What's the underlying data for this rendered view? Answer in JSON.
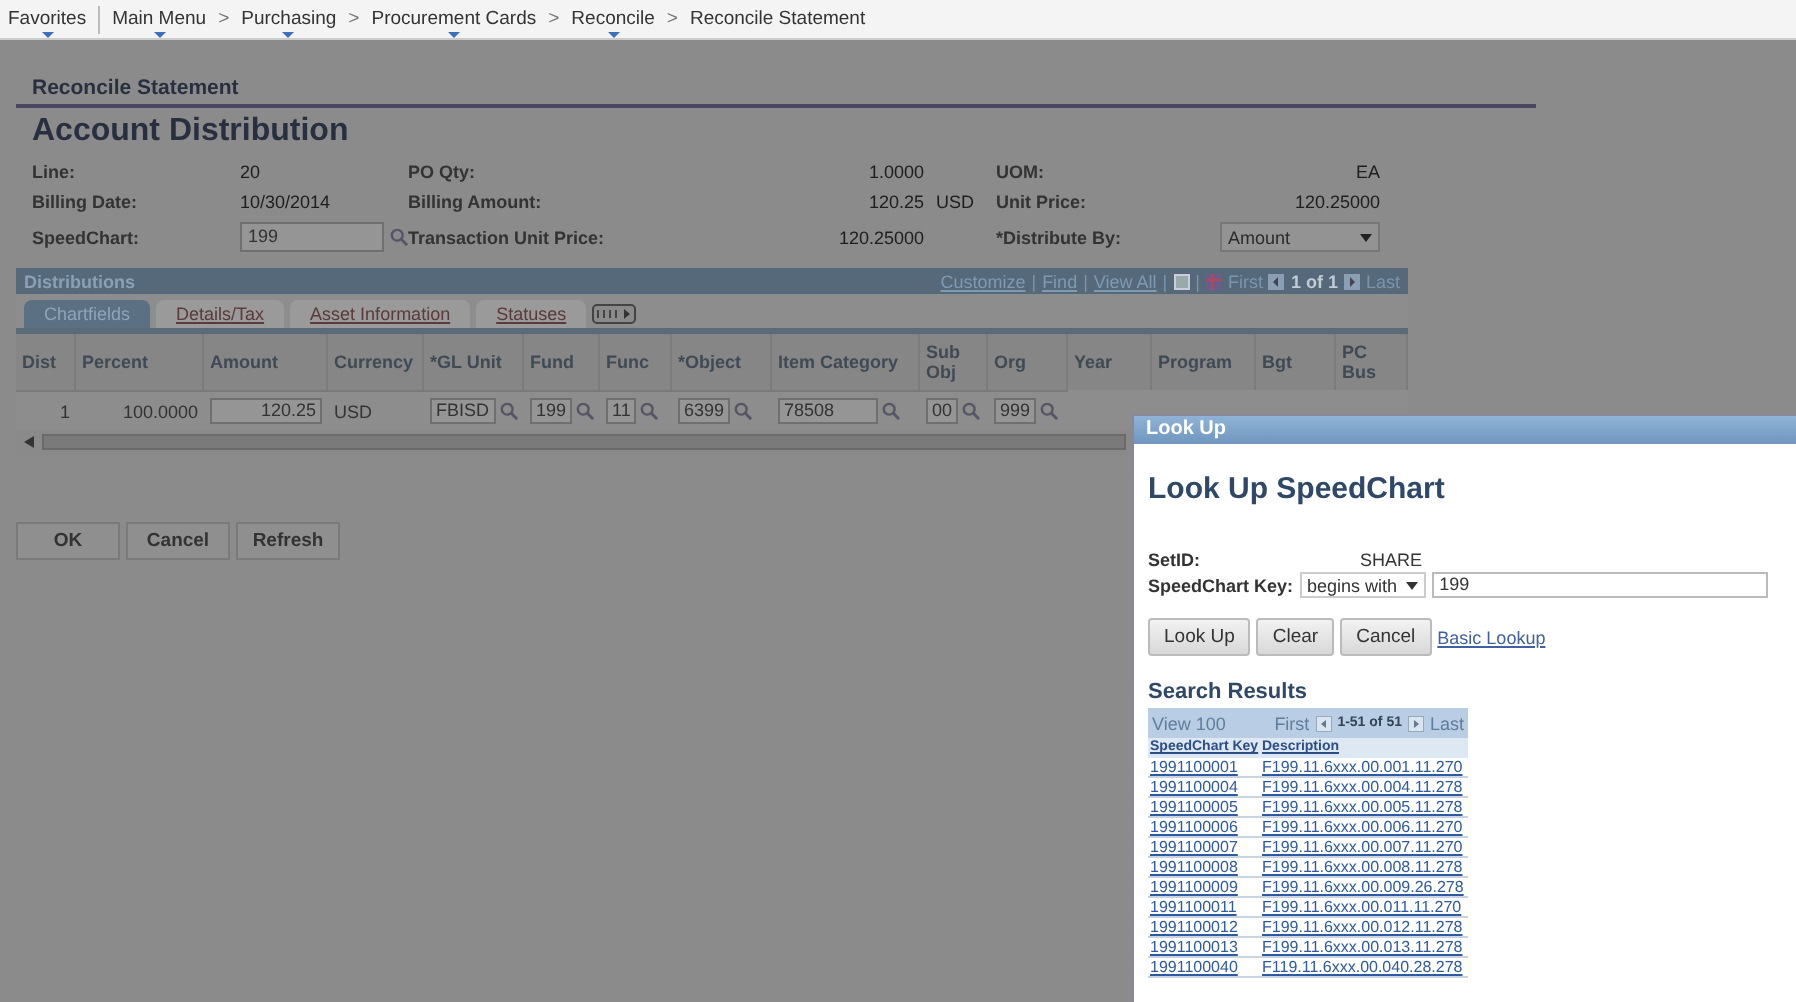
{
  "breadcrumb": [
    {
      "label": "Favorites",
      "menu": true
    },
    {
      "label": "Main Menu",
      "menu": true
    },
    {
      "label": "Purchasing",
      "menu": true
    },
    {
      "label": "Procurement Cards",
      "menu": true
    },
    {
      "label": "Reconcile",
      "menu": true
    },
    {
      "label": "Reconcile Statement",
      "menu": false
    }
  ],
  "breadcrumb_separator": [
    ">",
    ">",
    ">",
    ">"
  ],
  "page": {
    "section_title": "Reconcile Statement",
    "title": "Account Distribution"
  },
  "fields": [
    {
      "label": "Line:",
      "value": "20",
      "kind": "text"
    },
    {
      "label": "PO Qty:",
      "value": "1.0000",
      "kind": "number"
    },
    {
      "label": "UOM:",
      "value": "EA",
      "kind": "number"
    },
    {
      "label": "Billing Date:",
      "value": "10/30/2014",
      "kind": "text"
    },
    {
      "label": "Billing Amount:",
      "value": "120.25",
      "unit": "USD",
      "kind": "number"
    },
    {
      "label": "Unit Price:",
      "value": "120.25000",
      "kind": "number"
    },
    {
      "label": "SpeedChart:",
      "value": "199",
      "kind": "lookup"
    },
    {
      "label": "Transaction Unit Price:",
      "value": "120.25000",
      "kind": "number"
    },
    {
      "label": "*Distribute By:",
      "value": "Amount",
      "kind": "select"
    }
  ],
  "distributions": {
    "title": "Distributions",
    "nav": [
      {
        "kind": "link",
        "text": "Customize"
      },
      {
        "kind": "sep",
        "text": "|"
      },
      {
        "kind": "link",
        "text": "Find"
      },
      {
        "kind": "sep",
        "text": "|"
      },
      {
        "kind": "link",
        "text": "View All"
      },
      {
        "kind": "sep",
        "text": "|"
      },
      {
        "kind": "zoom"
      },
      {
        "kind": "sep",
        "text": "|"
      },
      {
        "kind": "download"
      },
      {
        "kind": "text",
        "text": "First"
      },
      {
        "kind": "prev"
      },
      {
        "kind": "count",
        "text": "1 of 1"
      },
      {
        "kind": "next"
      },
      {
        "kind": "text",
        "text": "Last"
      }
    ],
    "tabs": [
      {
        "label": "Chartfields",
        "selected": true
      },
      {
        "label": "Details/Tax",
        "selected": false
      },
      {
        "label": "Asset Information",
        "selected": false
      },
      {
        "label": "Statuses",
        "selected": false
      }
    ],
    "columns": [
      "Dist",
      "Percent",
      "Amount",
      "Currency",
      "*GL Unit",
      "Fund",
      "Func",
      "*Object",
      "Item Category",
      "Sub Obj",
      "Org",
      "Year",
      "Program",
      "Bgt",
      "PC Bus"
    ],
    "rows": [
      {
        "cells": [
          {
            "kind": "text",
            "value": "1"
          },
          {
            "kind": "text",
            "value": "100.0000"
          },
          {
            "kind": "input",
            "value": "120.25"
          },
          {
            "kind": "plain",
            "value": "USD"
          },
          {
            "kind": "lookup",
            "value": "FBISD"
          },
          {
            "kind": "lookup",
            "value": "199"
          },
          {
            "kind": "lookup",
            "value": "11"
          },
          {
            "kind": "lookup",
            "value": "6399"
          },
          {
            "kind": "lookup",
            "value": "78508"
          },
          {
            "kind": "lookup",
            "value": "00"
          },
          {
            "kind": "lookup",
            "value": "999"
          }
        ]
      }
    ]
  },
  "buttons": [
    "OK",
    "Cancel",
    "Refresh"
  ],
  "dialog": {
    "title": "Look Up",
    "heading": "Look Up SpeedChart",
    "setid": {
      "label": "SetID:",
      "value": "SHARE"
    },
    "key": {
      "label": "SpeedChart Key:",
      "operator": "begins with",
      "value": "199"
    },
    "buttons": [
      "Look Up",
      "Clear",
      "Cancel"
    ],
    "link": "Basic Lookup",
    "results": {
      "title": "Search Results",
      "view": "View 100",
      "first": "First",
      "counter": "1-51 of 51",
      "last": "Last",
      "columns": [
        "SpeedChart Key",
        "Description"
      ],
      "rows": [
        [
          "1991100001",
          "F199.11.6xxx.00.001.11.270"
        ],
        [
          "1991100004",
          "F199.11.6xxx.00.004.11.278"
        ],
        [
          "1991100005",
          "F199.11.6xxx.00.005.11.278"
        ],
        [
          "1991100006",
          "F199.11.6xxx.00.006.11.270"
        ],
        [
          "1991100007",
          "F199.11.6xxx.00.007.11.270"
        ],
        [
          "1991100008",
          "F199.11.6xxx.00.008.11.278"
        ],
        [
          "1991100009",
          "F199.11.6xxx.00.009.26.278"
        ],
        [
          "1991100011",
          "F199.11.6xxx.00.011.11.270"
        ],
        [
          "1991100012",
          "F199.11.6xxx.00.012.11.278"
        ],
        [
          "1991100013",
          "F199.11.6xxx.00.013.11.278"
        ],
        [
          "1991100040",
          "F119.11.6xxx.00.040.28.278"
        ]
      ]
    }
  }
}
